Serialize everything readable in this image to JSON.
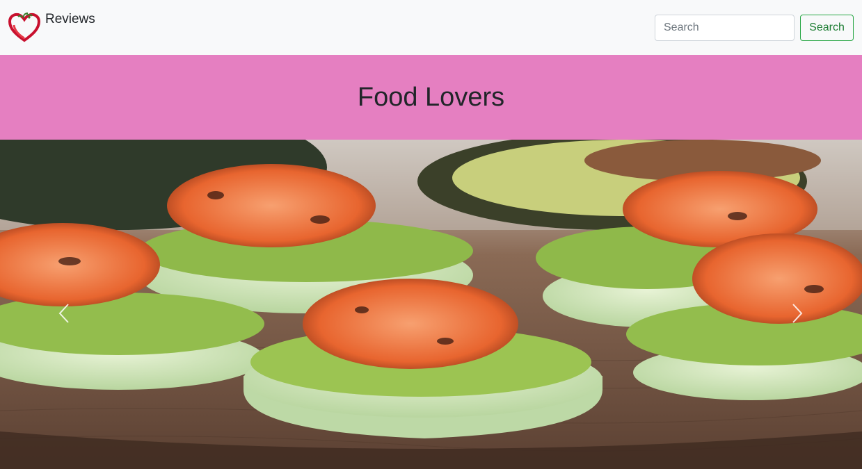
{
  "navbar": {
    "brand_label": "Reviews",
    "logo_icon": "heart-pepper-logo-icon",
    "search_placeholder": "Search",
    "search_button_label": "Search"
  },
  "banner": {
    "title": "Food Lovers",
    "background_color": "#e57fc1"
  },
  "carousel": {
    "slide_image": "shrimp-avocado-cucumber-bites-photo",
    "prev_icon": "chevron-left-icon",
    "next_icon": "chevron-right-icon"
  },
  "colors": {
    "navbar_bg": "#f8f9fa",
    "button_outline": "#28a745"
  }
}
